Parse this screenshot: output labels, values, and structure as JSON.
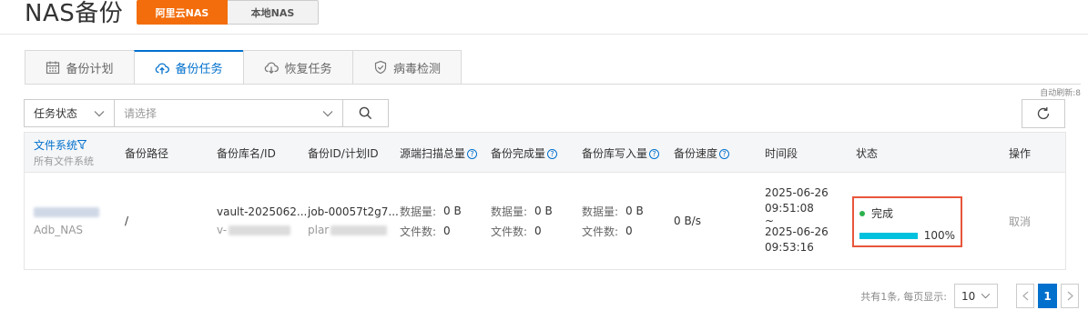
{
  "header": {
    "title": "NAS备份",
    "source_tabs": [
      {
        "label": "阿里云NAS",
        "active": true
      },
      {
        "label": "本地NAS",
        "active": false
      }
    ]
  },
  "tabs": [
    {
      "label": "备份计划",
      "icon": "calendar-icon",
      "active": false
    },
    {
      "label": "备份任务",
      "icon": "cloud-upload-icon",
      "active": true
    },
    {
      "label": "恢复任务",
      "icon": "cloud-download-icon",
      "active": false
    },
    {
      "label": "病毒检测",
      "icon": "shield-icon",
      "active": false
    }
  ],
  "auto_refresh": "自动刷新:8",
  "filter": {
    "key_label": "任务状态",
    "value_placeholder": "请选择"
  },
  "table": {
    "columns": {
      "filesystem": "文件系统",
      "filesystem_sub": "所有文件系统",
      "path": "备份路径",
      "vault": "备份库名/ID",
      "backup_id": "备份ID/计划ID",
      "scan_total": "源端扫描总量",
      "done_total": "备份完成量",
      "write_total": "备份库写入量",
      "speed": "备份速度",
      "period": "时间段",
      "status": "状态",
      "action": "操作"
    },
    "rows": [
      {
        "filesystem_name": "Adb_NAS",
        "path": "/",
        "vault_name": "vault-2025062...",
        "vault_id_prefix": "v-",
        "job_id": "job-00057t2g7...",
        "plan_id_prefix": "plar",
        "scan": {
          "data_label": "数据量:",
          "data_value": "0 B",
          "files_label": "文件数:",
          "files_value": "0"
        },
        "done": {
          "data_label": "数据量:",
          "data_value": "0 B",
          "files_label": "文件数:",
          "files_value": "0"
        },
        "write": {
          "data_label": "数据量:",
          "data_value": "0 B",
          "files_label": "文件数:",
          "files_value": "0"
        },
        "speed": "0 B/s",
        "start_date": "2025-06-26",
        "start_time": "09:51:08",
        "separator": "~",
        "end_date": "2025-06-26",
        "end_time": "09:53:16",
        "status": "完成",
        "progress": 100,
        "progress_text": "100%",
        "action": "取消"
      }
    ]
  },
  "pagination": {
    "info": "共有1条, 每页显示:",
    "page_size": "10",
    "current_page": "1"
  },
  "colors": {
    "accent": "#0070cc",
    "brand_orange": "#f36d0c",
    "status_success": "#2bb24c",
    "progress": "#00c1de",
    "highlight_box": "#e8553b"
  }
}
